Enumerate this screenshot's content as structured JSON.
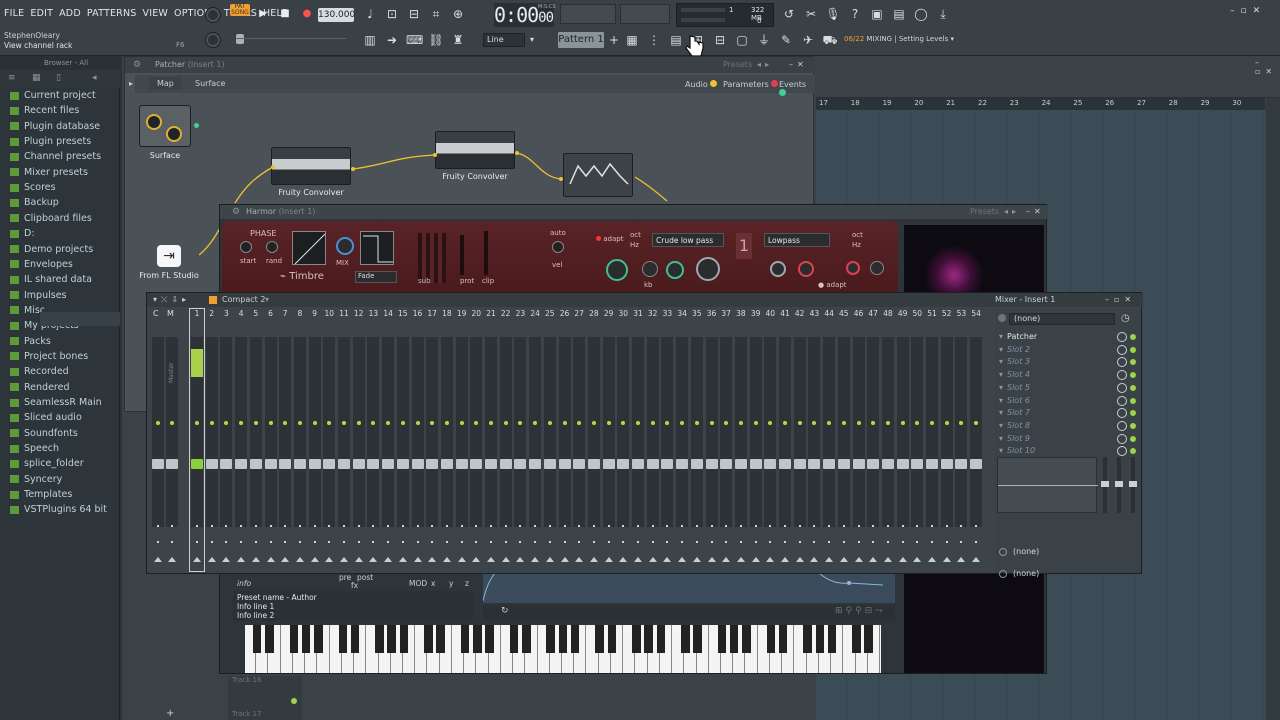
{
  "menu": [
    "FILE",
    "EDIT",
    "ADD",
    "PATTERNS",
    "VIEW",
    "OPTIONS",
    "TOOLS",
    "HELP"
  ],
  "user": {
    "name": "StephenOleary",
    "hint": "View channel rack",
    "hint_key": "F6"
  },
  "transport": {
    "pat_label": "PAT",
    "song_label": "SONG",
    "tempo": "130.000",
    "time": "0:00",
    "time_frac": "00",
    "time_unit": "M:S:CS"
  },
  "cpu": {
    "cpu_val": "1",
    "mem_val": "322 MB",
    "poly": "0"
  },
  "toolbar2": {
    "snap": "Line",
    "pattern": "Pattern 1",
    "hint_counter": "06/22",
    "hint_text": "MIXING | Setting Levels"
  },
  "browser": {
    "header": "Browser - All",
    "items": [
      {
        "label": "Current project",
        "color": "#5c9a3a"
      },
      {
        "label": "Recent files",
        "color": "#5c9a3a"
      },
      {
        "label": "Plugin database",
        "color": "#5c9a3a"
      },
      {
        "label": "Plugin presets",
        "color": "#5c9a3a"
      },
      {
        "label": "Channel presets",
        "color": "#5c9a3a"
      },
      {
        "label": "Mixer presets",
        "color": "#5c9a3a"
      },
      {
        "label": "Scores",
        "color": "#5c9a3a"
      },
      {
        "label": "Backup",
        "color": "#5c9a3a"
      },
      {
        "label": "Clipboard files",
        "color": "#5c9a3a"
      },
      {
        "label": "D:",
        "color": "#5c9a3a"
      },
      {
        "label": "Demo projects",
        "color": "#5c9a3a"
      },
      {
        "label": "Envelopes",
        "color": "#5c9a3a"
      },
      {
        "label": "IL shared data",
        "color": "#5c9a3a"
      },
      {
        "label": "Impulses",
        "color": "#5c9a3a"
      },
      {
        "label": "Misc",
        "color": "#5c9a3a"
      },
      {
        "label": "My projects",
        "color": "#5c9a3a"
      },
      {
        "label": "Packs",
        "color": "#5c9a3a"
      },
      {
        "label": "Project bones",
        "color": "#5c9a3a"
      },
      {
        "label": "Recorded",
        "color": "#5c9a3a"
      },
      {
        "label": "Rendered",
        "color": "#5c9a3a"
      },
      {
        "label": "SeamlessR Main",
        "color": "#5c9a3a"
      },
      {
        "label": "Sliced audio",
        "color": "#5c9a3a"
      },
      {
        "label": "Soundfonts",
        "color": "#5c9a3a"
      },
      {
        "label": "Speech",
        "color": "#5c9a3a"
      },
      {
        "label": "splice_folder",
        "color": "#5c9a3a"
      },
      {
        "label": "Syncery",
        "color": "#5c9a3a"
      },
      {
        "label": "Templates",
        "color": "#5c9a3a"
      },
      {
        "label": "VSTPlugins 64 bit",
        "color": "#5c9a3a"
      }
    ]
  },
  "patcher": {
    "title": "Patcher",
    "insert": "(Insert 1)",
    "presets": "Presets",
    "tabs": [
      "Map",
      "Surface"
    ],
    "legend": {
      "audio": "Audio",
      "params": "Parameters",
      "events": "Events"
    },
    "nodes": {
      "surface": "Surface",
      "conv1": "Fruity Convolver",
      "conv2": "Fruity Convolver",
      "from": "From FL Studio"
    }
  },
  "harmor": {
    "title": "Harmor",
    "insert": "(Insert 1)",
    "presets": "Presets",
    "labels": {
      "phase": "PHASE",
      "start": "start",
      "rand": "rand",
      "mix": "MIX",
      "timbre": "Timbre",
      "fade": "Fade",
      "sub": "sub",
      "prot": "prot",
      "clip": "clip",
      "auto": "auto",
      "vel": "vel",
      "adapt": "adapt",
      "oct": "oct",
      "hz": "Hz",
      "filter1": "Crude low pass",
      "filter2": "Lowpass",
      "kb": "kb",
      "adapt2": "adapt",
      "number": "1"
    },
    "info": {
      "tab": "info",
      "pre": "pre",
      "post": "post",
      "fx": "fx",
      "mod": "MOD",
      "x": "x",
      "y": "y",
      "z": "z",
      "line1": "Preset name - Author",
      "line2": "Info line 1",
      "line3": "Info line 2"
    }
  },
  "mixer": {
    "title": "Compact 2",
    "side_title": "Mixer - Insert 1",
    "cm": [
      "C",
      "M"
    ],
    "tracks": [
      "1",
      "2",
      "3",
      "4",
      "5",
      "6",
      "7",
      "8",
      "9",
      "10",
      "11",
      "12",
      "13",
      "14",
      "15",
      "16",
      "17",
      "18",
      "19",
      "20",
      "21",
      "22",
      "23",
      "24",
      "25",
      "26",
      "27",
      "28",
      "29",
      "30",
      "31",
      "32",
      "33",
      "34",
      "35",
      "36",
      "37",
      "38",
      "39",
      "40",
      "41",
      "42",
      "43",
      "44",
      "45",
      "46",
      "47",
      "48",
      "49",
      "50",
      "51",
      "52",
      "53",
      "54"
    ],
    "master": "Master",
    "insert_none": "(none)",
    "slots": [
      "Patcher",
      "Slot 2",
      "Slot 3",
      "Slot 4",
      "Slot 5",
      "Slot 6",
      "Slot 7",
      "Slot 8",
      "Slot 9",
      "Slot 10"
    ],
    "send1": "(none)",
    "send2": "(none)"
  },
  "playlist": {
    "ruler": [
      "17",
      "18",
      "19",
      "20",
      "21",
      "22",
      "23",
      "24",
      "25",
      "26",
      "27",
      "28",
      "29",
      "30"
    ],
    "track16": "Track 16",
    "track17": "Track 17"
  }
}
